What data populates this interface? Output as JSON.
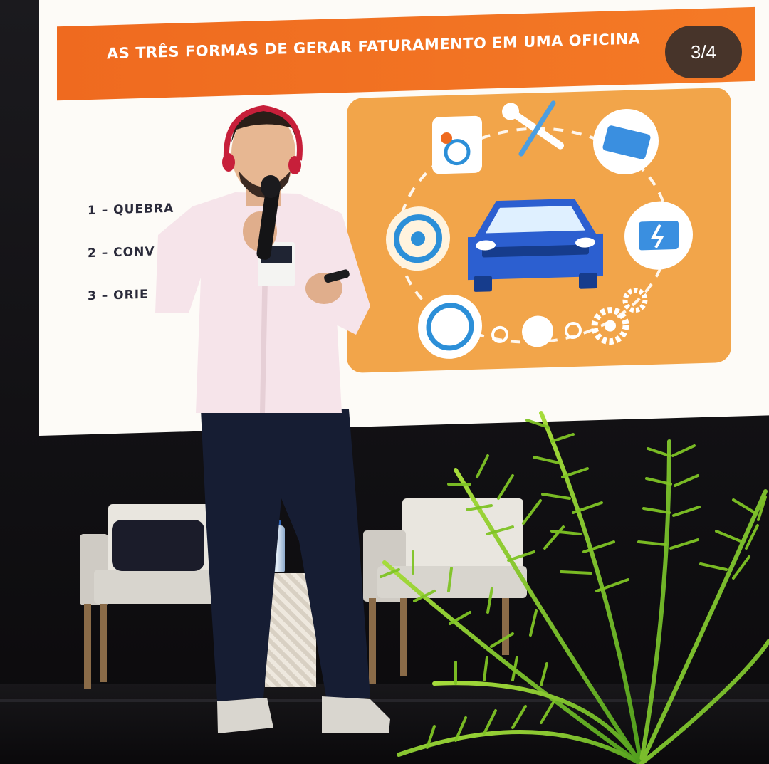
{
  "slide": {
    "title": "AS TRÊS FORMAS DE GERAR FATURAMENTO EM UMA OFICINA",
    "items": [
      "1 – QUEBRA",
      "2 – CONV",
      "3 – ORIE"
    ]
  },
  "viewer": {
    "page_indicator": "3/4"
  },
  "colors": {
    "header_orange": "#ef6a1f",
    "panel_orange": "#f2a54a",
    "car_blue": "#2c5fd0",
    "fern_green": "#7fc425",
    "shirt_pink": "#f6e4ea"
  },
  "icons": [
    "gear-icon",
    "wrench-icon",
    "engine-icon",
    "oil-can-icon",
    "brake-disc-icon",
    "car-icon",
    "battery-icon",
    "tire-icon"
  ]
}
